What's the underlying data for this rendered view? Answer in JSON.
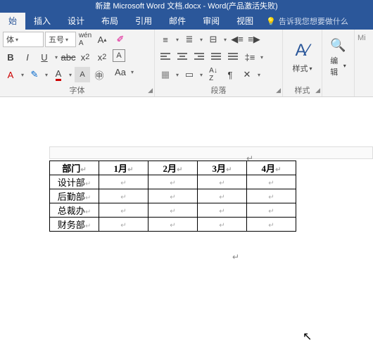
{
  "title": "新建 Microsoft Word 文档.docx - Word(产品激活失败)",
  "tabs": {
    "home": "始",
    "insert": "插入",
    "design": "设计",
    "layout": "布局",
    "references": "引用",
    "mail": "邮件",
    "review": "审阅",
    "view": "视图"
  },
  "tell_me": "告诉我您想要做什么",
  "font": {
    "name": "体",
    "size": "五号",
    "group_label": "字体"
  },
  "para": {
    "group_label": "段落"
  },
  "styles": {
    "label": "样式",
    "group_label": "样式"
  },
  "editing": {
    "label": "编辑"
  },
  "chart_data": {
    "type": "table",
    "headers": [
      "部门",
      "1月",
      "2月",
      "3月",
      "4月"
    ],
    "rows": [
      [
        "设计部",
        "",
        "",
        "",
        ""
      ],
      [
        "后勤部",
        "",
        "",
        "",
        ""
      ],
      [
        "总裁办",
        "",
        "",
        "",
        ""
      ],
      [
        "财务部",
        "",
        "",
        "",
        ""
      ]
    ]
  }
}
